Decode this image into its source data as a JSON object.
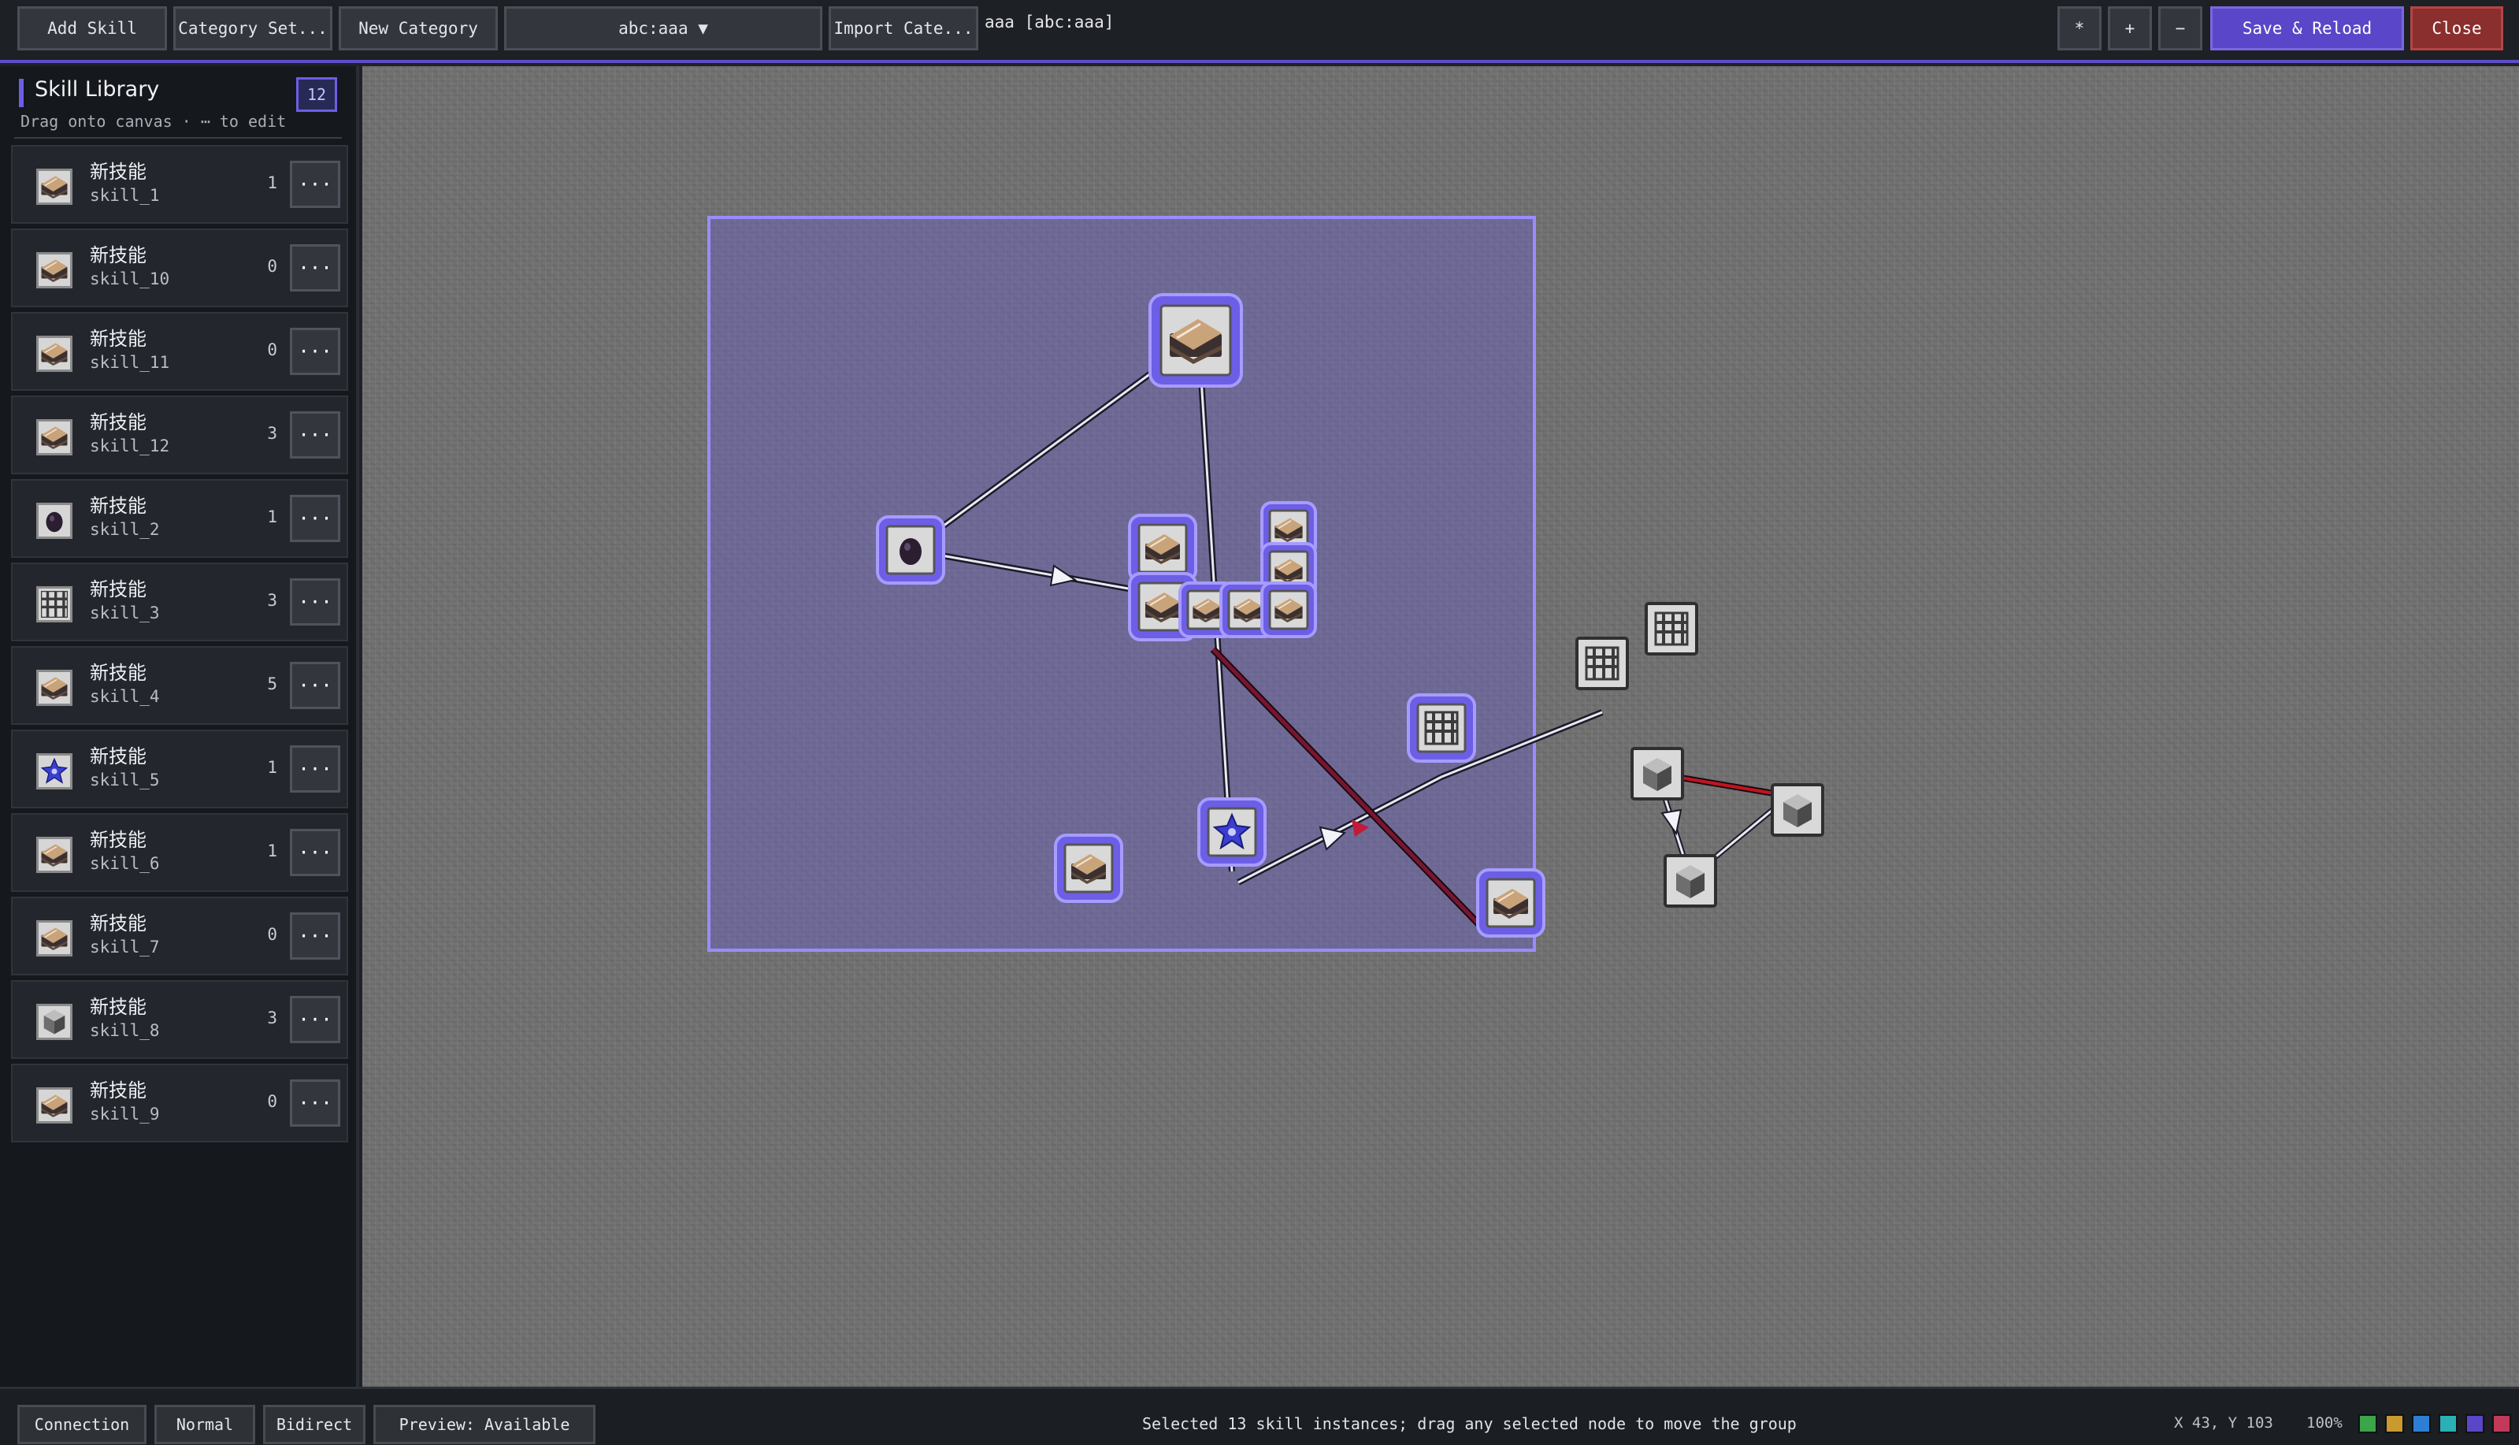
{
  "toolbar": {
    "add_skill": "Add Skill",
    "category_settings": "Category Set...",
    "new_category": "New Category",
    "category_select": "abc:aaa ▼",
    "import_category": "Import Cate...",
    "current_category": "aaa [abc:aaa]",
    "btn_star": "*",
    "btn_plus": "+",
    "btn_minus": "−",
    "save_reload": "Save & Reload",
    "close": "Close"
  },
  "sidebar": {
    "title": "Skill Library",
    "count": "12",
    "hint": "Drag onto canvas · ⋯ to edit",
    "more_label": "···",
    "skills": [
      {
        "name": "新技能",
        "id": "skill_1",
        "count": "1",
        "icon": "book"
      },
      {
        "name": "新技能",
        "id": "skill_10",
        "count": "0",
        "icon": "book"
      },
      {
        "name": "新技能",
        "id": "skill_11",
        "count": "0",
        "icon": "book"
      },
      {
        "name": "新技能",
        "id": "skill_12",
        "count": "3",
        "icon": "book"
      },
      {
        "name": "新技能",
        "id": "skill_2",
        "count": "1",
        "icon": "orb"
      },
      {
        "name": "新技能",
        "id": "skill_3",
        "count": "3",
        "icon": "grid"
      },
      {
        "name": "新技能",
        "id": "skill_4",
        "count": "5",
        "icon": "book"
      },
      {
        "name": "新技能",
        "id": "skill_5",
        "count": "1",
        "icon": "star"
      },
      {
        "name": "新技能",
        "id": "skill_6",
        "count": "1",
        "icon": "book"
      },
      {
        "name": "新技能",
        "id": "skill_7",
        "count": "0",
        "icon": "book"
      },
      {
        "name": "新技能",
        "id": "skill_8",
        "count": "3",
        "icon": "cube"
      },
      {
        "name": "新技能",
        "id": "skill_9",
        "count": "0",
        "icon": "book"
      }
    ]
  },
  "canvas": {
    "selected_count": 13,
    "colors": {
      "selection_fill": "#6a5fd0",
      "selection_border": "#8f82ff",
      "link_normal": "#e8e8f0",
      "link_bidirect": "#7a1530"
    }
  },
  "statusbar": {
    "connection": "Connection",
    "normal": "Normal",
    "bidirect": "Bidirect",
    "preview": "Preview: Available",
    "message": "Selected 13 skill instances; drag any selected node to move the group",
    "coords": "X 43, Y 103",
    "zoom": "100%",
    "swatches": [
      "#3aa54a",
      "#c99a2e",
      "#2d7fd6",
      "#2ab0b5",
      "#5a46c8",
      "#c23a5a"
    ]
  }
}
